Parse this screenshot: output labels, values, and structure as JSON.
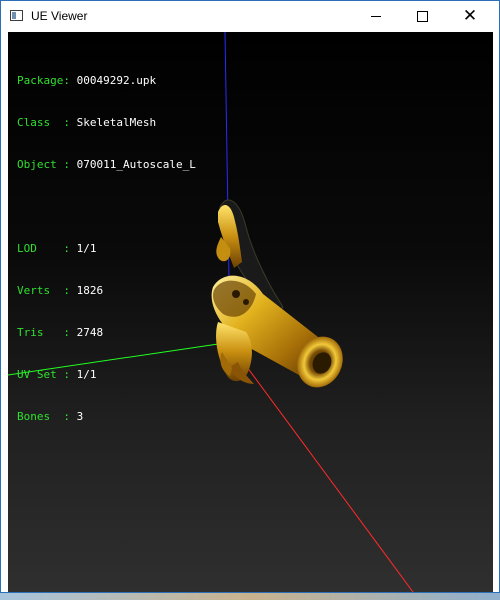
{
  "window": {
    "title": "UE Viewer"
  },
  "info": {
    "package_label": "Package",
    "package_value": "00049292.upk",
    "class_label": "Class  ",
    "class_value": "SkeletalMesh",
    "object_label": "Object ",
    "object_value": "070011_Autoscale_L",
    "lod_label": "LOD    ",
    "lod_value": "1/1",
    "verts_label": "Verts  ",
    "verts_value": "1826",
    "tris_label": "Tris   ",
    "tris_value": "2748",
    "uvset_label": "UV Set ",
    "uvset_value": "1/1",
    "bones_label": "Bones  ",
    "bones_value": "3"
  },
  "axes": {
    "x_color": "#ff2a2a",
    "y_color": "#22ff22",
    "z_color": "#2a2aff"
  },
  "model": {
    "color": "#d8a416"
  }
}
